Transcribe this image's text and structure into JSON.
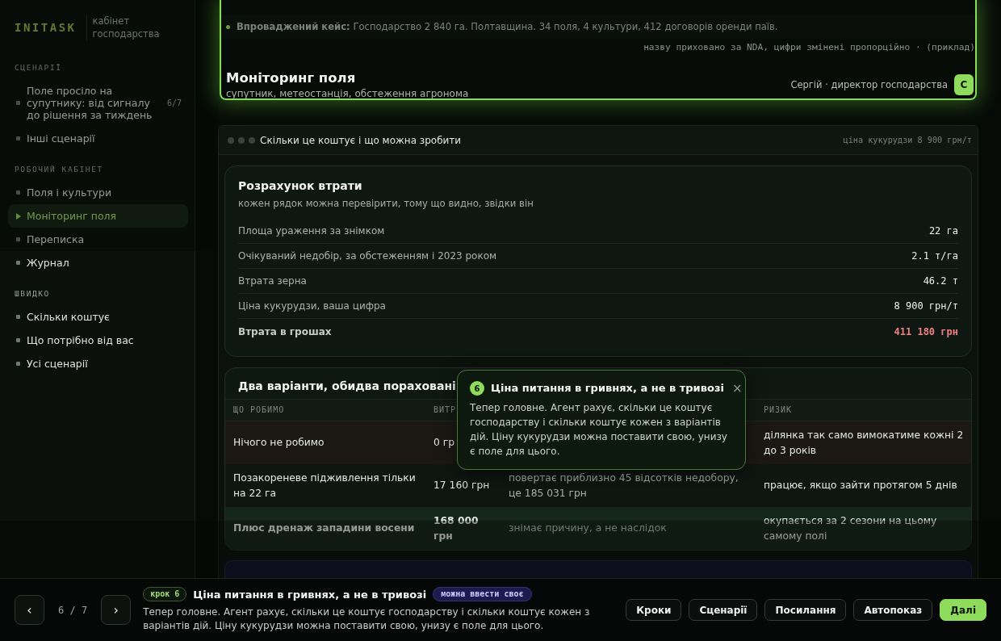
{
  "sidebar": {
    "logo": "INITASK",
    "subtitle": "кабінет господарства",
    "sections": [
      {
        "heading": "СЦЕНАРІЇ",
        "items": [
          {
            "label": "Поле просіло на супутнику: від сигналу до рішення за тиждень",
            "badge": "6/7",
            "selected": false
          },
          {
            "label": "Інші сценарії",
            "selected": false
          }
        ]
      },
      {
        "heading": "РОБОЧИЙ КАБІНЕТ",
        "items": [
          {
            "label": "Поля і культури",
            "selected": false
          },
          {
            "label": "Моніторинг поля",
            "selected": true
          },
          {
            "label": "Переписка",
            "selected": false
          },
          {
            "label": "Журнал",
            "selected": false
          }
        ]
      },
      {
        "heading": "ШВИДКО",
        "items": [
          {
            "label": "Скільки коштує",
            "selected": false
          },
          {
            "label": "Що потрібно від вас",
            "selected": false
          },
          {
            "label": "Усі сценарії",
            "selected": false
          }
        ]
      }
    ]
  },
  "header": {
    "case_note": "**Впроваджений кейс:** Господарство 2 840 га. Полтавщина. 34 поля, 4 культури, 412 договорів оренди паїв.",
    "note": "назву приховано за NDA, цифри змінені пропорційно · (приклад)",
    "title": "Моніторинг поля",
    "subtitle": "супутник, метеостанція, обстеження агронома",
    "user": "Сергій · директор господарства",
    "avatar": "С"
  },
  "panel": {
    "title": "Скільки це коштує і що можна зробити",
    "price_note": "ціна кукурудзи 8 900 грн/т",
    "loss_card": {
      "title": "Розрахунок втрати",
      "subtitle": "кожен рядок можна перевірити, тому що видно, звідки він",
      "rows": [
        {
          "kind": "plain",
          "label": "Площа ураження за знімком",
          "value": "22 га"
        },
        {
          "kind": "plain",
          "label": "Очікуваний недобір, за обстеженням і 2023 роком",
          "value": "2.1 т/га"
        },
        {
          "kind": "plain",
          "label": "Втрата зерна",
          "value": "46.2 т"
        },
        {
          "kind": "plain",
          "label": "Ціна кукурудзи, ваша цифра",
          "value": "8 900 грн/т"
        },
        {
          "kind": "total",
          "label": "Втрата в грошах",
          "value": "411 180 грн"
        }
      ]
    },
    "options_card": {
      "title": "Два варіанти, обидва пораховані",
      "columns": {
        "column_1": "ЩО РОБИМО",
        "column_2": "ВИТР",
        "column_4": "РИЗИК"
      },
      "rows": [
        {
          "kind": "risk",
          "column_1": "Нічого не робимо",
          "column_2": "0 гр",
          "column_4": "ділянка так само вимокатиме кожні 2 до 3 років"
        },
        {
          "kind": "plain",
          "column_1": "Позакореневе підживлення тільки на 22 га",
          "column_2": "17 160 грн",
          "column_3": "повертає приблизно 45 відсотків недобору, це 185 031 грн",
          "column_4": "працює, якщо зайти протягом 5 днів"
        },
        {
          "kind": "recommended",
          "column_1": "Плюс дренаж западини восени",
          "column_2": "168 000 грн",
          "column_3": "знімає причину, а не наслідок",
          "column_4": "окупається за 2 сезони на цьому самому полі"
        }
      ]
    }
  },
  "tooltip": {
    "number": "6",
    "title": "Ціна питання в гривнях, а не в тривозі",
    "close": "×",
    "body": "Тепер головне. Агент рахує, скільки це коштує господарству і скільки коштує кожен з варіантів дій. Ціну кукурудзи можна поставити свою, унизу є поле для цього."
  },
  "tour": {
    "prev": "‹",
    "counter": "6 / 7",
    "next": "›",
    "step_badge": "крок 6",
    "title": "Ціна питання в гривнях, а не в тривозі",
    "tag": "можна ввести своє",
    "description": "Тепер головне. Агент рахує, скільки це коштує господарству і скільки коштує кожен з варіантів дій. Ціну кукурудзи можна поставити свою, унизу є поле для цього.",
    "buttons": [
      {
        "label": "Кроки",
        "primary": false
      },
      {
        "label": "Сценарії",
        "primary": false
      },
      {
        "label": "Посилання",
        "primary": false
      },
      {
        "label": "Автопоказ",
        "primary": false
      },
      {
        "label": "Далі",
        "primary": true
      }
    ]
  }
}
